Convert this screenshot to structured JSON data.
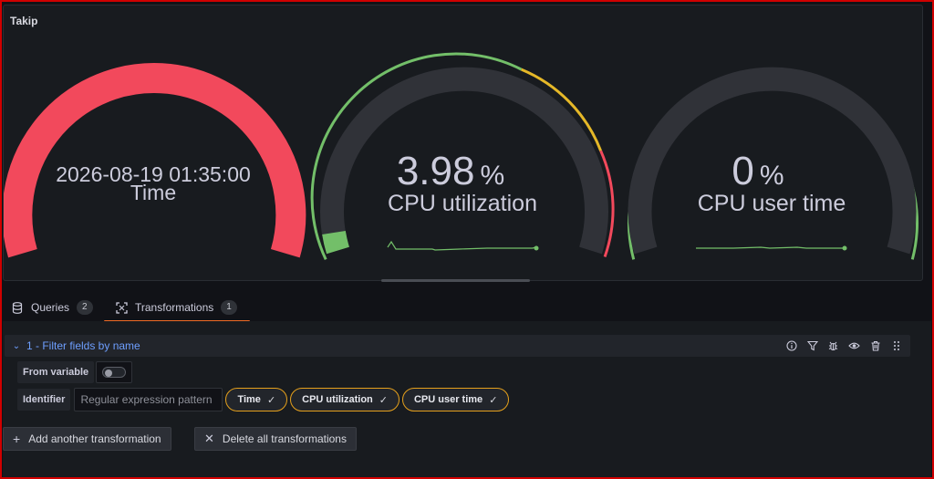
{
  "panel": {
    "title": "Takip",
    "gauges": [
      {
        "value_text": "2026-08-19 01:35:00",
        "unit": "",
        "label": "Time",
        "fill_fraction": 1.0,
        "color": "#f2495c"
      },
      {
        "value_text": "3.98",
        "unit": "%",
        "label": "CPU utilization",
        "fill_fraction": 0.0398,
        "color": "#73bf69"
      },
      {
        "value_text": "0",
        "unit": "%",
        "label": "CPU user time",
        "fill_fraction": 0.0,
        "color": "#73bf69"
      }
    ],
    "threshold_colors": {
      "ok": "#73bf69",
      "warn": "#fade2a",
      "warn2": "#ff9830",
      "crit": "#f2495c"
    }
  },
  "tabs": [
    {
      "label": "Queries",
      "count": "2",
      "icon": "database-icon",
      "active": false
    },
    {
      "label": "Transformations",
      "count": "1",
      "icon": "transformation-icon",
      "active": true
    }
  ],
  "transformation": {
    "title": "1 - Filter fields by name",
    "actions": [
      "info-icon",
      "filter-icon",
      "bug-icon",
      "eye-icon",
      "trash-icon",
      "drag-handle-icon"
    ],
    "from_variable_label": "From variable",
    "from_variable_enabled": false,
    "identifier_label": "Identifier",
    "regex_placeholder": "Regular expression pattern",
    "fields": [
      "Time",
      "CPU utilization",
      "CPU user time"
    ]
  },
  "buttons": {
    "add": "Add another transformation",
    "delete_all": "Delete all transformations"
  },
  "accent_color": "#f06a25",
  "link_color": "#6e9fff"
}
